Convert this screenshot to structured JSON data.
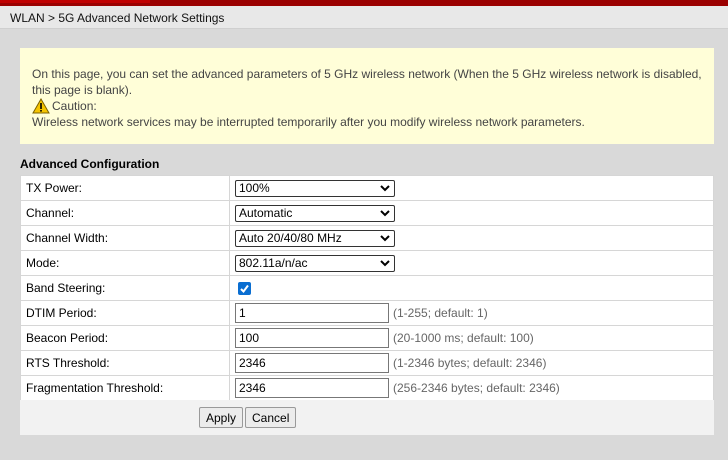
{
  "breadcrumb": "WLAN > 5G Advanced Network Settings",
  "notice": {
    "text": "On this page, you can set the advanced parameters of 5 GHz wireless network (When the 5 GHz wireless network is disabled, this page is blank).",
    "caution_label": "Caution:",
    "caution_text": "Wireless network services may be interrupted temporarily after you modify wireless network parameters."
  },
  "section_title": "Advanced Configuration",
  "fields": {
    "tx_power": {
      "label": "TX Power:",
      "value": "100%"
    },
    "channel": {
      "label": "Channel:",
      "value": "Automatic"
    },
    "channel_width": {
      "label": "Channel Width:",
      "value": "Auto 20/40/80 MHz"
    },
    "mode": {
      "label": "Mode:",
      "value": "802.11a/n/ac"
    },
    "band_steering": {
      "label": "Band Steering:",
      "checked": true
    },
    "dtim": {
      "label": "DTIM Period:",
      "value": "1",
      "hint": "(1-255; default: 1)"
    },
    "beacon": {
      "label": "Beacon Period:",
      "value": "100",
      "hint": "(20-1000 ms; default: 100)"
    },
    "rts": {
      "label": "RTS Threshold:",
      "value": "2346",
      "hint": "(1-2346 bytes; default: 2346)"
    },
    "frag": {
      "label": "Fragmentation Threshold:",
      "value": "2346",
      "hint": "(256-2346 bytes; default: 2346)"
    }
  },
  "buttons": {
    "apply": "Apply",
    "cancel": "Cancel"
  },
  "colors": {
    "brand": "#c00000",
    "notice_bg": "#fffed8",
    "checkbox": "#0a6ed1"
  }
}
